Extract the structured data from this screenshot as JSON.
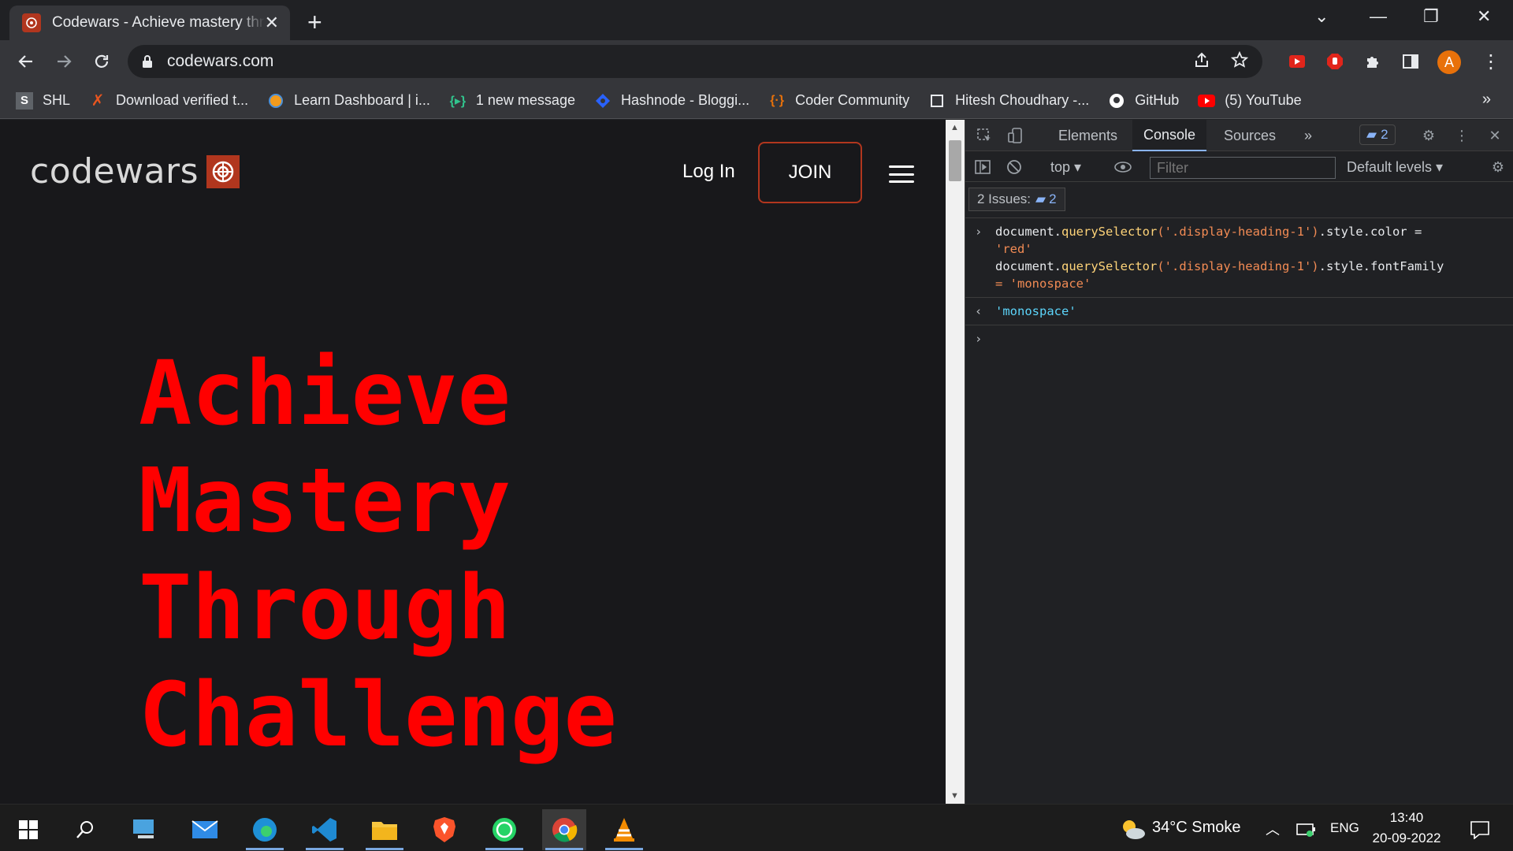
{
  "browser": {
    "tab_title": "Codewars - Achieve mastery through challenge",
    "tab_close": "✕",
    "new_tab": "+",
    "url": "codewars.com",
    "window_controls": {
      "menu": "⌄",
      "minimize": "—",
      "restore": "❐",
      "close": "✕"
    },
    "avatar_letter": "A",
    "more_menu": "⋮"
  },
  "bookmarks": [
    {
      "label": "SHL",
      "icon": "shl-icon",
      "color": "#9aa0a6"
    },
    {
      "label": "Download verified t...",
      "icon": "x-icon",
      "color": "#e8551f"
    },
    {
      "label": "Learn Dashboard | i...",
      "icon": "circle-icon",
      "color": "#f29b1d"
    },
    {
      "label": "1 new message",
      "icon": "braces-icon",
      "color": "#31c48d"
    },
    {
      "label": "Hashnode - Bloggi...",
      "icon": "hashnode-icon",
      "color": "#2962ff"
    },
    {
      "label": "Coder Community",
      "icon": "braces-icon",
      "color": "#e8710a"
    },
    {
      "label": "Hitesh Choudhary -...",
      "icon": "square-icon",
      "color": "#e8eaed"
    },
    {
      "label": "GitHub",
      "icon": "github-icon",
      "color": "#ffffff"
    },
    {
      "label": "(5) YouTube",
      "icon": "youtube-icon",
      "color": "#ff0000"
    }
  ],
  "bookmarks_overflow": "»",
  "page": {
    "logo_text": "codewars",
    "login_label": "Log In",
    "join_label": "JOIN",
    "hero_lines": [
      "Achieve",
      "Mastery",
      "Through",
      "Challenge"
    ],
    "hero_color": "#ff0000"
  },
  "devtools": {
    "tabs": [
      "Elements",
      "Console",
      "Sources"
    ],
    "active_tab": "Console",
    "more_tabs": "»",
    "issues_count": "2",
    "context": "top ▾",
    "filter_placeholder": "Filter",
    "levels": "Default levels ▾",
    "issues_label": "2 Issues:",
    "console": {
      "line1_obj": "document.",
      "line1_method": "querySelector",
      "line1_arg": "('.display-heading-1')",
      "line1_rest": ".style.color =",
      "line1_value": "'red'",
      "line2_obj": "document.",
      "line2_method": "querySelector",
      "line2_arg": "('.display-heading-1')",
      "line2_rest": ".style.fontFamily",
      "line2_value": "= 'monospace'",
      "result": "'monospace'"
    }
  },
  "taskbar": {
    "weather": "34°C  Smoke",
    "language": "ENG",
    "time": "13:40",
    "date": "20-09-2022"
  }
}
